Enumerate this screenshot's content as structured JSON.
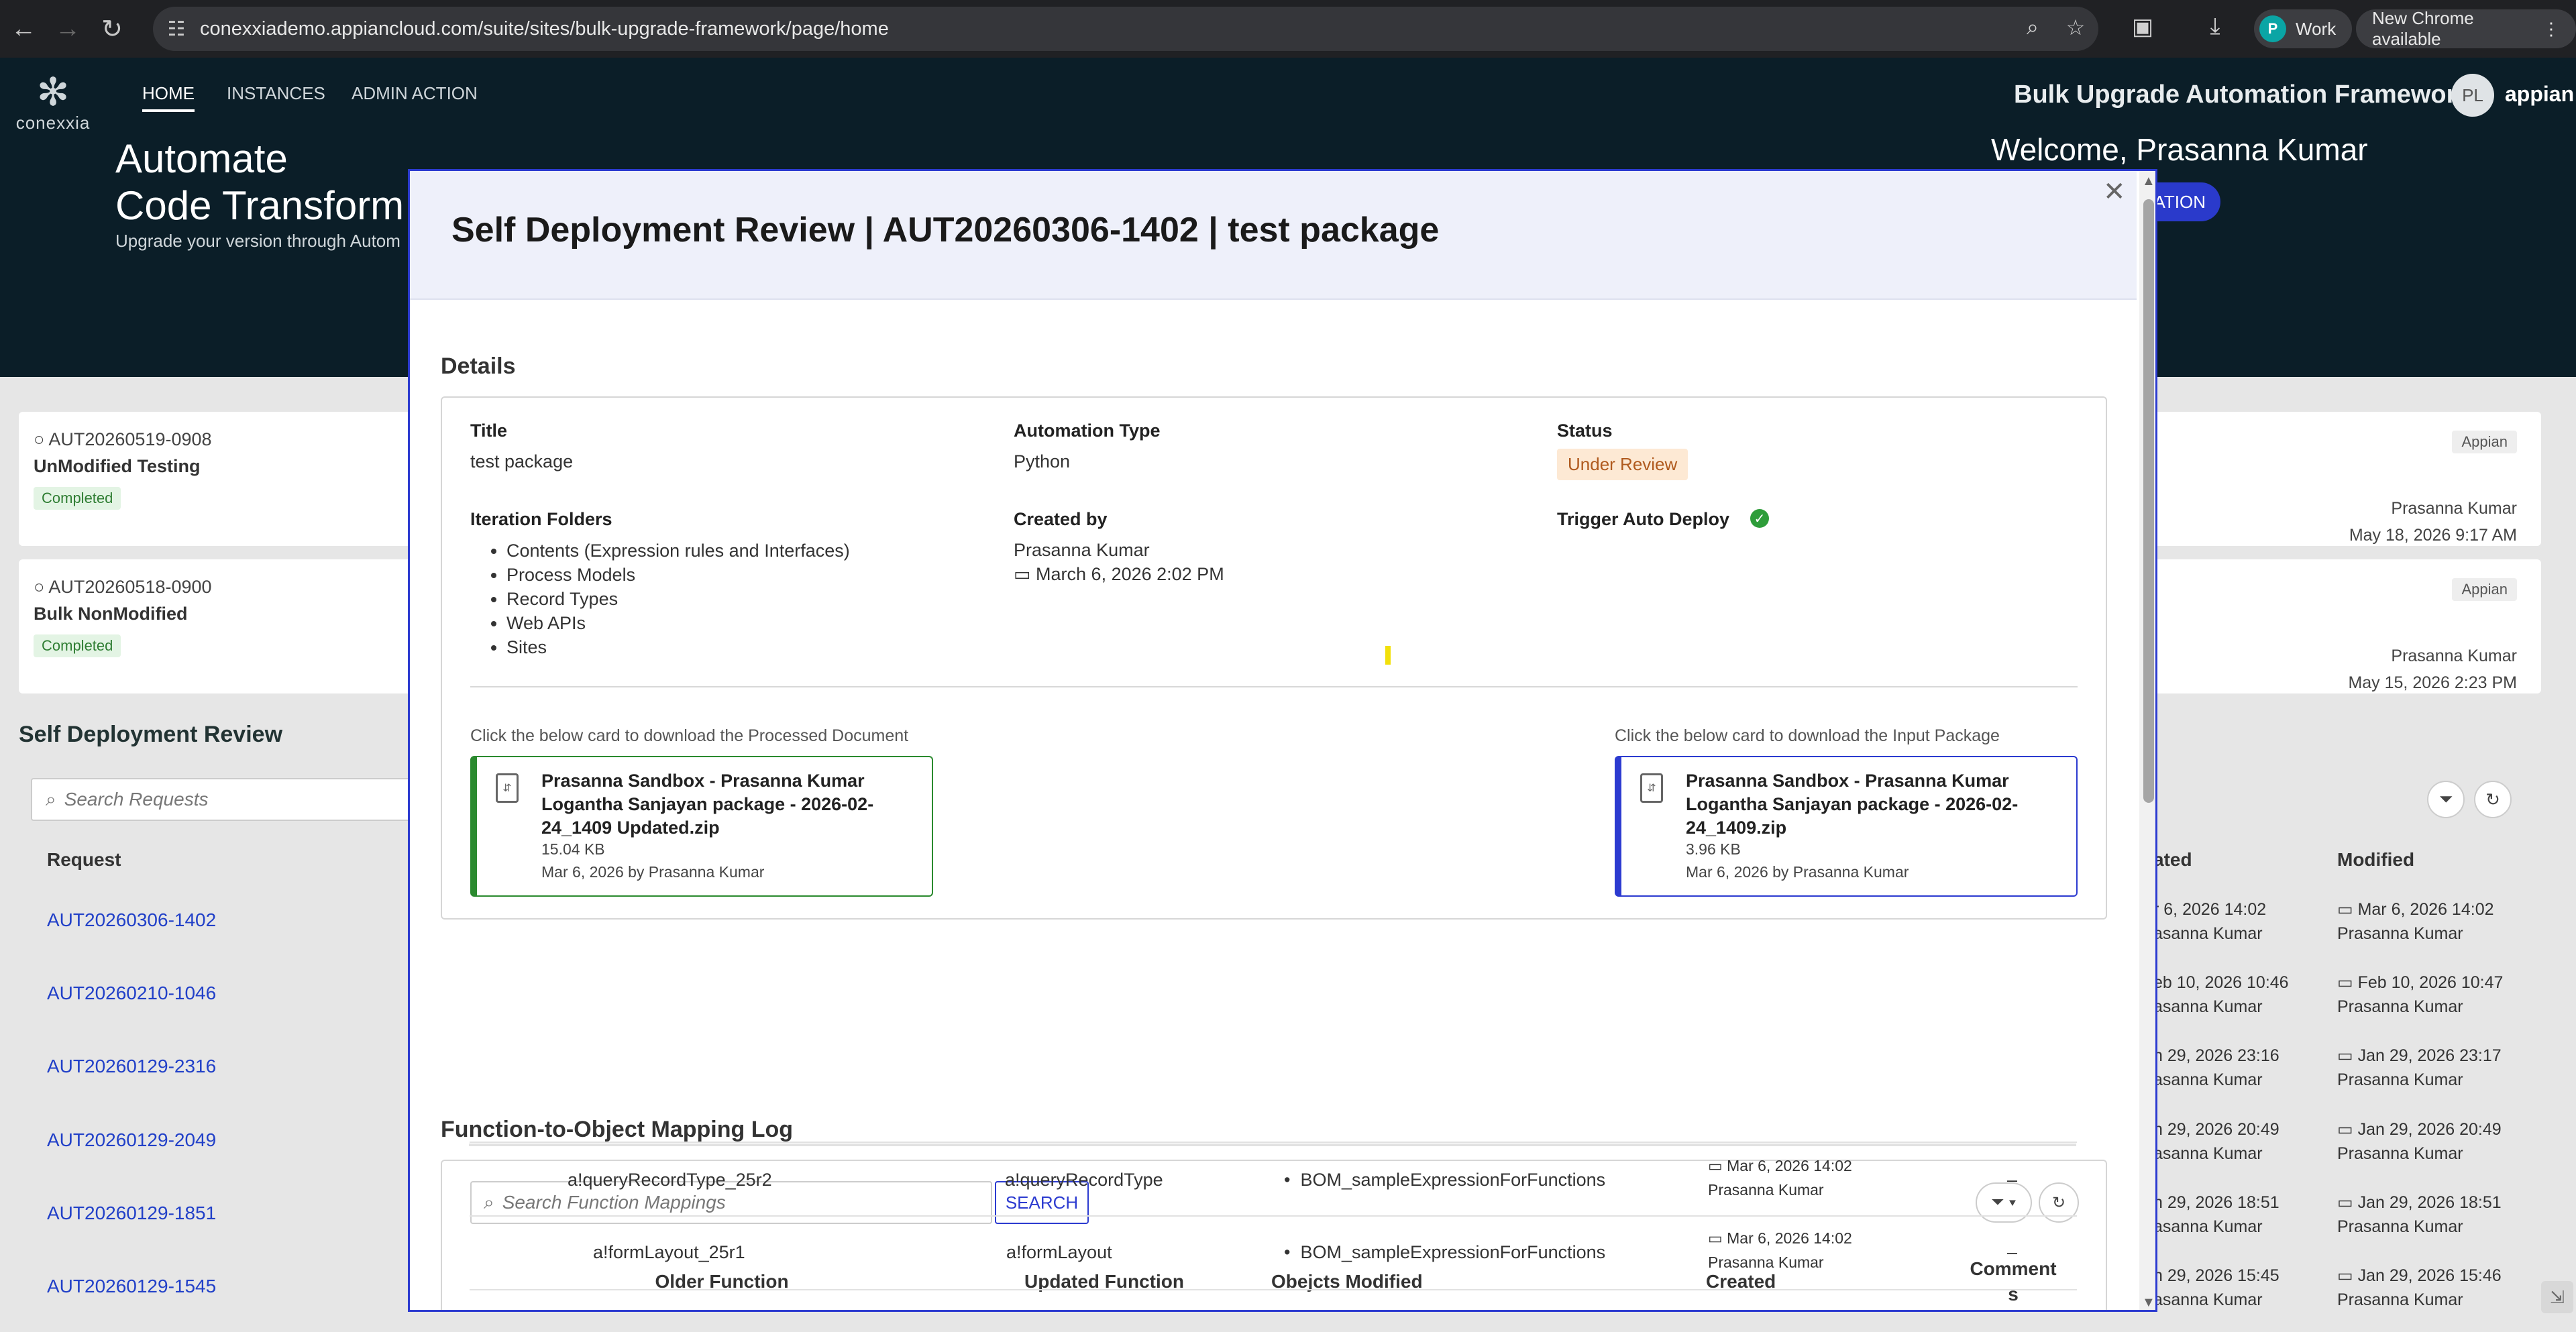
{
  "browser": {
    "url": "conexxiademo.appiancloud.com/suite/sites/bulk-upgrade-framework/page/home",
    "profile_initial": "P",
    "profile_label": "Work",
    "update_label": "New Chrome available"
  },
  "app": {
    "logo_text": "conexxia",
    "nav": [
      "HOME",
      "INSTANCES",
      "ADMIN ACTION"
    ],
    "title": "Bulk Upgrade Automation Framework",
    "avatar_initials": "PL",
    "brand": "appian",
    "hero_line1": "Automate",
    "hero_line2": "Code Transform",
    "hero_sub": "Upgrade your version through Autom",
    "welcome": "Welcome, Prasanna Kumar",
    "hero_button": "ATION"
  },
  "background": {
    "cards": [
      {
        "id": "AUT20260519-0908",
        "title": "UnModified Testing",
        "status": "Completed",
        "tag": "Appian",
        "by": "Prasanna Kumar",
        "date": "May 18, 2026 9:17 AM"
      },
      {
        "id": "AUT20260518-0900",
        "title": "Bulk NonModified",
        "status": "Completed",
        "tag": "Appian",
        "by": "Prasanna Kumar",
        "date": "May 15, 2026 2:23 PM"
      }
    ],
    "section_title": "Self Deployment Review",
    "search_placeholder": "Search Requests",
    "col_request": "Request",
    "col_created": "ated",
    "col_modified": "Modified",
    "rows": [
      {
        "request": "AUT20260306-1402",
        "created": "r 6, 2026 14:02",
        "created_by": "asanna Kumar",
        "modified": "Mar 6, 2026 14:02",
        "modified_by": "Prasanna Kumar"
      },
      {
        "request": "AUT20260210-1046",
        "created": "eb 10, 2026 10:46",
        "created_by": "asanna Kumar",
        "modified": "Feb 10, 2026 10:47",
        "modified_by": "Prasanna Kumar"
      },
      {
        "request": "AUT20260129-2316",
        "created": "n 29, 2026 23:16",
        "created_by": "asanna Kumar",
        "modified": "Jan 29, 2026 23:17",
        "modified_by": "Prasanna Kumar"
      },
      {
        "request": "AUT20260129-2049",
        "created": "n 29, 2026 20:49",
        "created_by": "asanna Kumar",
        "modified": "Jan 29, 2026 20:49",
        "modified_by": "Prasanna Kumar"
      },
      {
        "request": "AUT20260129-1851",
        "created": "n 29, 2026 18:51",
        "created_by": "asanna Kumar",
        "modified": "Jan 29, 2026 18:51",
        "modified_by": "Prasanna Kumar"
      },
      {
        "request": "AUT20260129-1545",
        "created": "n 29, 2026 15:45",
        "created_by": "asanna Kumar",
        "modified": "Jan 29, 2026 15:46",
        "modified_by": "Prasanna Kumar"
      }
    ]
  },
  "modal": {
    "title": "Self Deployment Review | AUT20260306-1402 | test package",
    "details_heading": "Details",
    "title_label": "Title",
    "title_value": "test package",
    "automation_type_label": "Automation Type",
    "automation_type_value": "Python",
    "status_label": "Status",
    "status_value": "Under Review",
    "iteration_folders_label": "Iteration Folders",
    "iteration_folders": [
      "Contents (Expression rules and Interfaces)",
      "Process Models",
      "Record Types",
      "Web APIs",
      "Sites"
    ],
    "created_by_label": "Created by",
    "created_by_value": "Prasanna Kumar",
    "created_date": "March 6, 2026 2:02 PM",
    "trigger_label": "Trigger Auto Deploy",
    "processed_hint": "Click the below card to download the Processed Document",
    "input_hint": "Click the below card to download the Input Package",
    "processed_doc": {
      "name": "Prasanna Sandbox - Prasanna Kumar Logantha Sanjayan package - 2026-02-24_1409 Updated.zip",
      "size": "15.04 KB",
      "by": "Mar 6, 2026 by Prasanna Kumar"
    },
    "input_doc": {
      "name": "Prasanna Sandbox - Prasanna Kumar Logantha Sanjayan package - 2026-02-24_1409.zip",
      "size": "3.96 KB",
      "by": "Mar 6, 2026 by Prasanna Kumar"
    },
    "mapping_heading": "Function-to-Object Mapping Log",
    "mapping_search_placeholder": "Search Function Mappings",
    "mapping_search_button": "SEARCH",
    "columns": [
      "Older Function",
      "Updated Function",
      "Obejcts Modified",
      "Created",
      "Comment",
      "s"
    ],
    "rows": [
      {
        "older": "a!queryRecordType_25r2",
        "updated": "a!queryRecordType",
        "object": "BOM_sampleExpressionForFunctions",
        "created": "Mar 6, 2026 14:02",
        "created_by": "Prasanna Kumar",
        "comment": "–"
      },
      {
        "older": "a!formLayout_25r1",
        "updated": "a!formLayout",
        "object": "BOM_sampleExpressionForFunctions",
        "created": "Mar 6, 2026 14:02",
        "created_by": "Prasanna Kumar",
        "comment": "–"
      }
    ]
  }
}
